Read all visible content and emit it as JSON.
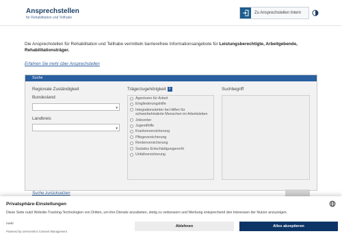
{
  "header": {
    "title": "Ansprechstellen",
    "subtitle": "für Rehabilitation und Teilhabe",
    "intern_button": "Zu Ansprechstellen Intern",
    "intern_icon": "login-icon",
    "contrast_icon": "contrast-icon"
  },
  "intro": {
    "text_plain": "Die Ansprechstellen für Rehabilitation und Teilhabe vermitteln barrierefreie Informationsangebote für ",
    "text_bold": "Leistungsberechtigte, Arbeitgebende, Rehabilitationsträger.",
    "more_link": "Erfahren Sie mehr über Ansprechstellen"
  },
  "search": {
    "panel_title": "Suche",
    "regional_label": "Regionale Zuständigkeit",
    "bundesland_label": "Bundesland",
    "bundesland_value": "",
    "landkreis_label": "Landkreis",
    "landkreis_value": "",
    "traeger_label": "Trägerzugehörigkeit",
    "info_badge": "i",
    "suchbegriff_label": "Suchbegriff",
    "options": [
      "Agenturen für Arbeit",
      "Eingliederungshilfe",
      "Integrationsämter bei Hilfen für schwerbehinderte Menschen im Arbeitsleben",
      "Jobcenter",
      "Jugendhilfe",
      "Krankenversicherung",
      "Pflegeversicherung",
      "Rentenversicherung",
      "Soziales Entschädigungsrecht",
      "Unfallversicherung"
    ],
    "reset_link": "Suche zurücksetzen"
  },
  "consent": {
    "title": "Privatsphäre-Einstellungen",
    "text": "Diese Seite nutzt Website-Tracking-Technologien von Dritten, um ihre Dienste anzubieten, stetig zu verbessern und Werbung entsprechend den Interessen der Nutzer anzuzeigen.",
    "more": "mehr",
    "powered": "Powered by Usercentrics Consent Management",
    "deny_button": "Ablehnen",
    "accept_button": "Alles akzeptieren",
    "language_icon": "globe-icon"
  },
  "colors": {
    "brand": "#1c3f66",
    "panel_header": "#2a5fa0",
    "accept": "#0c3466"
  }
}
